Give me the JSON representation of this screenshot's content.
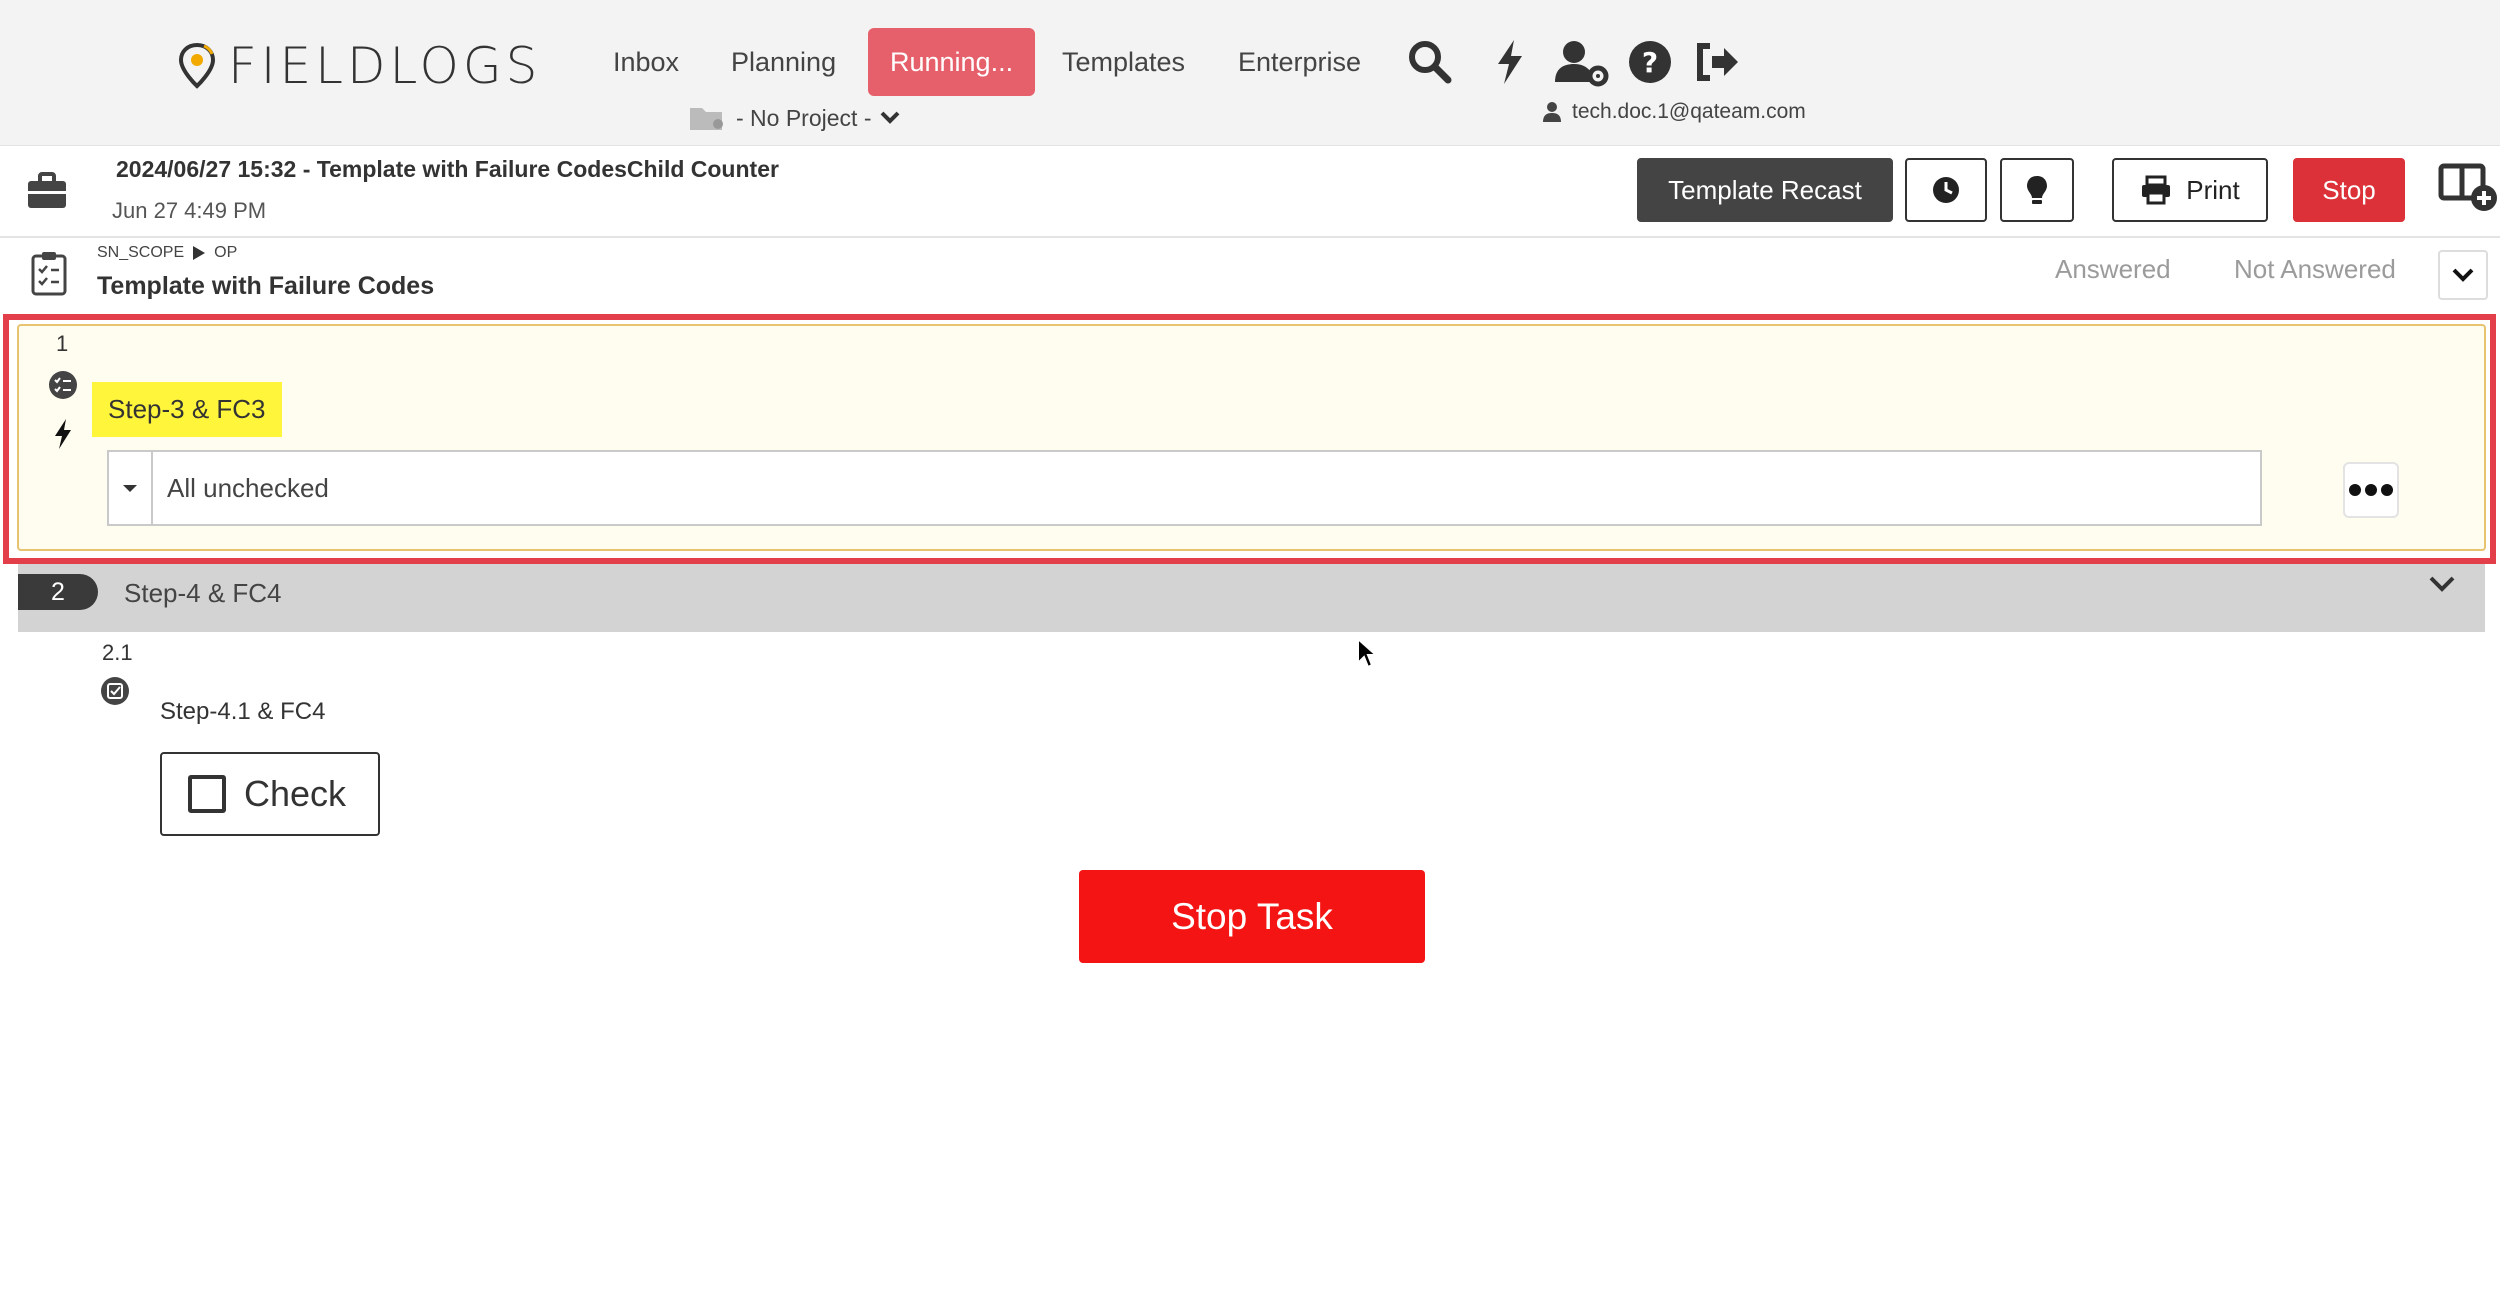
{
  "brand": {
    "name": "FIELDLOGS"
  },
  "nav": {
    "items": [
      {
        "label": "Inbox"
      },
      {
        "label": "Planning"
      },
      {
        "label": "Running..."
      },
      {
        "label": "Templates"
      },
      {
        "label": "Enterprise"
      }
    ],
    "active": "Running...",
    "icons": [
      "search-icon",
      "bolt-icon",
      "user-settings-icon",
      "help-icon",
      "logout-icon"
    ],
    "project": "- No Project -",
    "user": "tech.doc.1@qateam.com"
  },
  "task": {
    "title": "2024/06/27 15:32 - Template with Failure CodesChild Counter",
    "date": "Jun 27 4:49 PM",
    "buttons": {
      "recast": "Template Recast",
      "print": "Print",
      "stop": "Stop"
    }
  },
  "section": {
    "breadcrumb": [
      "SN_SCOPE",
      "OP"
    ],
    "title": "Template with Failure Codes",
    "filters": {
      "answered": "Answered",
      "not_answered": "Not Answered"
    }
  },
  "steps": {
    "step1": {
      "number": "1",
      "label": "Step-3 & FC3",
      "value": "All unchecked"
    },
    "step2": {
      "number": "2",
      "label": "Step-4 & FC4"
    },
    "step21": {
      "number": "2.1",
      "label": "Step-4.1 & FC4",
      "check_label": "Check"
    }
  },
  "actions": {
    "stop_task": "Stop Task"
  },
  "colors": {
    "active_nav": "#e6606b",
    "stop_red": "#dc3138",
    "stop_task_red": "#f51414",
    "highlight_border": "#e23f4b",
    "step_label_highlight": "#fff53b"
  }
}
